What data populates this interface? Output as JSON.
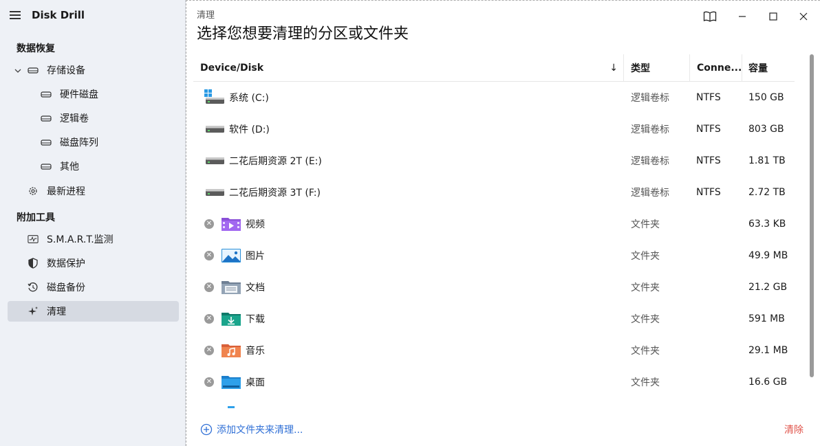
{
  "app": {
    "title": "Disk Drill"
  },
  "sidebar": {
    "section_recovery": "数据恢复",
    "storage": "存储设备",
    "storage_children": [
      "硬件磁盘",
      "逻辑卷",
      "磁盘阵列",
      "其他"
    ],
    "recent": "最新进程",
    "section_tools": "附加工具",
    "tools": [
      "S.M.A.R.T.监测",
      "数据保护",
      "磁盘备份",
      "清理"
    ]
  },
  "main": {
    "breadcrumb": "清理",
    "heading": "选择您想要清理的分区或文件夹",
    "columns": {
      "device": "Device/Disk",
      "sort_arrow": "↓",
      "type": "类型",
      "conn": "Conne...",
      "size": "容量"
    },
    "rows": [
      {
        "name": "系统 (C:)",
        "type": "逻辑卷标",
        "conn": "NTFS",
        "size": "150 GB",
        "icon": "windows-drive-icon"
      },
      {
        "name": "软件 (D:)",
        "type": "逻辑卷标",
        "conn": "NTFS",
        "size": "803 GB",
        "icon": "drive-icon"
      },
      {
        "name": "二花后期资源 2T (E:)",
        "type": "逻辑卷标",
        "conn": "NTFS",
        "size": "1.81 TB",
        "icon": "drive-icon"
      },
      {
        "name": "二花后期资源 3T (F:)",
        "type": "逻辑卷标",
        "conn": "NTFS",
        "size": "2.72 TB",
        "icon": "drive-icon"
      },
      {
        "name": "视频",
        "type": "文件夹",
        "conn": "",
        "size": "63.3 KB",
        "icon": "video-folder-icon"
      },
      {
        "name": "图片",
        "type": "文件夹",
        "conn": "",
        "size": "49.9 MB",
        "icon": "pictures-folder-icon"
      },
      {
        "name": "文档",
        "type": "文件夹",
        "conn": "",
        "size": "21.2 GB",
        "icon": "documents-folder-icon"
      },
      {
        "name": "下载",
        "type": "文件夹",
        "conn": "",
        "size": "591 MB",
        "icon": "downloads-folder-icon"
      },
      {
        "name": "音乐",
        "type": "文件夹",
        "conn": "",
        "size": "29.1 MB",
        "icon": "music-folder-icon"
      },
      {
        "name": "桌面",
        "type": "文件夹",
        "conn": "",
        "size": "16.6 GB",
        "icon": "desktop-folder-icon"
      }
    ],
    "add_folder": "添加文件夹来清理...",
    "clear": "清除"
  },
  "colors": {
    "accent_blue": "#2f6fd6",
    "danger_red": "#e0534a",
    "sidebar_bg": "#eef1f6",
    "active_bg": "#d6dae2"
  }
}
